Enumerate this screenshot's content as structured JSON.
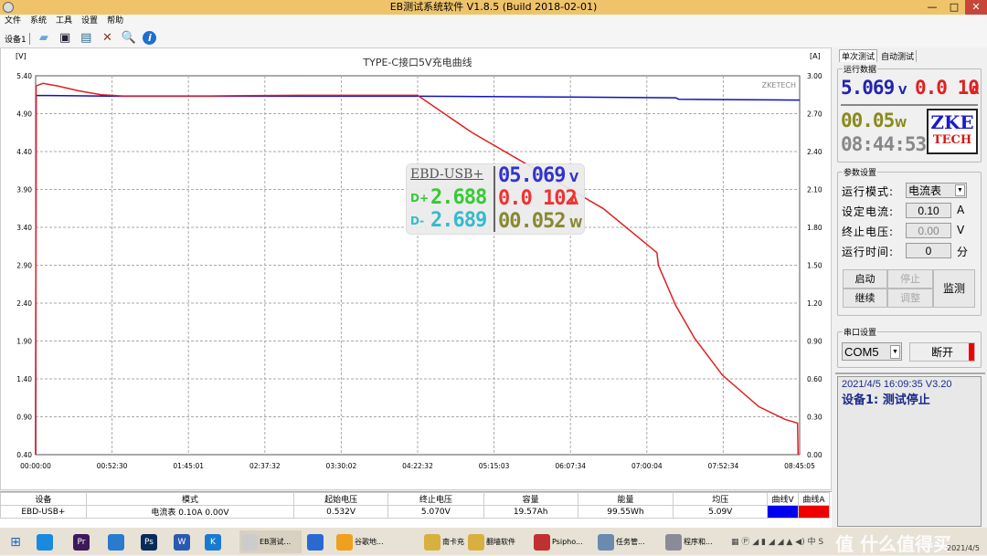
{
  "window": {
    "title": "EB测试系统软件 V1.8.5 (Build 2018-02-01)",
    "minimize": "—",
    "maximize": "□",
    "close": "✕"
  },
  "menu": [
    "文件",
    "系统",
    "工具",
    "设置",
    "帮助"
  ],
  "toolbar": {
    "device_label": "设备1",
    "icons": [
      "open-folder-icon",
      "save-icon",
      "chart-image-icon",
      "tools-icon",
      "search-icon",
      "info-icon"
    ]
  },
  "chart_data": {
    "type": "line",
    "title": "TYPE-C接口5V充电曲线",
    "ylabel": "[V]",
    "y2label": "[A]",
    "watermark": "ZKETECH",
    "ylim": [
      0.4,
      5.4
    ],
    "y2lim": [
      0.0,
      3.0
    ],
    "yticks": [
      "5.40",
      "4.90",
      "4.40",
      "3.90",
      "3.40",
      "2.90",
      "2.40",
      "1.90",
      "1.40",
      "0.90",
      "0.40"
    ],
    "y2ticks": [
      "3.00",
      "2.70",
      "2.40",
      "2.10",
      "1.80",
      "1.50",
      "1.20",
      "0.90",
      "0.60",
      "0.30",
      "0.00"
    ],
    "xticks": [
      "00:00:00",
      "00:52:30",
      "01:45:01",
      "02:37:32",
      "03:30:02",
      "04:22:32",
      "05:15:03",
      "06:07:34",
      "07:00:04",
      "07:52:34",
      "08:45:05"
    ],
    "xlim": [
      "00:00:00",
      "08:45:05"
    ],
    "grid": true,
    "series": [
      {
        "name": "曲线V",
        "axis": "left",
        "color": "#1010c0",
        "points": [
          [
            "00:00:00",
            0.4
          ],
          [
            "00:00:20",
            5.14
          ],
          [
            "00:10:00",
            5.14
          ],
          [
            "01:00:00",
            5.13
          ],
          [
            "04:22:30",
            5.13
          ],
          [
            "06:00:00",
            5.12
          ],
          [
            "07:20:00",
            5.11
          ],
          [
            "07:22:00",
            5.09
          ],
          [
            "08:45:05",
            5.08
          ]
        ]
      },
      {
        "name": "曲线A",
        "axis": "right",
        "color": "#e02020",
        "points": [
          [
            "00:00:00",
            0.0
          ],
          [
            "00:00:20",
            2.92
          ],
          [
            "00:05:00",
            2.94
          ],
          [
            "00:15:00",
            2.92
          ],
          [
            "00:30:00",
            2.88
          ],
          [
            "00:45:00",
            2.85
          ],
          [
            "01:00:00",
            2.84
          ],
          [
            "02:00:00",
            2.84
          ],
          [
            "03:00:00",
            2.845
          ],
          [
            "04:22:30",
            2.845
          ],
          [
            "05:00:00",
            2.55
          ],
          [
            "05:45:00",
            2.25
          ],
          [
            "06:30:00",
            1.95
          ],
          [
            "07:07:00",
            1.6
          ],
          [
            "07:08:00",
            1.5
          ],
          [
            "07:20:00",
            1.18
          ],
          [
            "07:33:00",
            0.92
          ],
          [
            "07:52:00",
            0.63
          ],
          [
            "08:17:00",
            0.38
          ],
          [
            "08:35:00",
            0.28
          ],
          [
            "08:43:40",
            0.25
          ],
          [
            "08:44:00",
            0.0
          ]
        ]
      }
    ]
  },
  "overlay": {
    "device": "EBD-USB+",
    "dplus_label": "D+",
    "dplus": "2.688",
    "dminus_label": "D-",
    "dminus": "2.689",
    "voltage": "05.069",
    "v_unit": "V",
    "current": "0.0 102",
    "a_unit": "A",
    "power": "00.052",
    "w_unit": "W"
  },
  "right": {
    "tabs": [
      "单次测试",
      "自动测试"
    ],
    "run_group": "运行数据",
    "voltage": "5.069",
    "v_unit": "V",
    "current": "0.0 10",
    "a_unit": "A",
    "power": "00.05",
    "w_unit": "W",
    "time": "08:44:53",
    "logo": "ZKE TECH",
    "param_group": "参数设置",
    "mode_label": "运行模式:",
    "mode_value": "电流表",
    "set_current_label": "设定电流:",
    "set_current": "0.10",
    "set_current_unit": "A",
    "end_voltage_label": "终止电压:",
    "end_voltage": "0.00",
    "end_voltage_unit": "V",
    "run_time_label": "运行时间:",
    "run_time": "0",
    "run_time_unit": "分",
    "buttons": {
      "start": "启动",
      "stop": "停止",
      "continue": "继续",
      "adjust": "调整",
      "monitor": "监测"
    },
    "serial_group": "串口设置",
    "port": "COM5",
    "disconnect": "断开",
    "status_line1": "2021/4/5 16:09:35  V3.20",
    "status_line2": "设备1: 测试停止"
  },
  "table": {
    "headers": [
      "设备",
      "模式",
      "起始电压",
      "终止电压",
      "容量",
      "能量",
      "均压",
      "曲线V",
      "曲线A"
    ],
    "rows": [
      [
        "EBD-USB+",
        "电流表  0.10A  0.00V",
        "0.532V",
        "5.070V",
        "19.57Ah",
        "99.55Wh",
        "5.09V",
        "",
        ""
      ]
    ],
    "curve_colors": [
      "#0000ee",
      "#ee0000"
    ]
  },
  "taskbar": {
    "items": [
      "",
      "",
      "Pr",
      "",
      "Ps",
      "W",
      "K",
      "EB测试...",
      "",
      "谷歌地...",
      "南卡充...",
      "翻墙软件",
      "Psipho...",
      "任务管...",
      "程序和..."
    ],
    "clock": "2021/4/5",
    "watermark": "值 什么值得买"
  }
}
